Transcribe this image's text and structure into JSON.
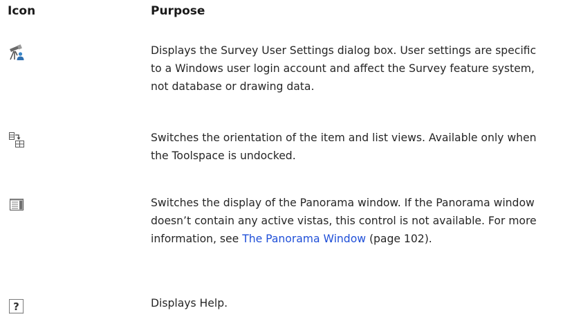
{
  "header": {
    "icon_label": "Icon",
    "purpose_label": "Purpose"
  },
  "rows": [
    {
      "icon": "survey-user-settings-icon",
      "text": "Displays the Survey User Settings dialog box. User settings are specific to a Windows user login account and affect the Survey feature system, not database or drawing data."
    },
    {
      "icon": "switch-orientation-icon",
      "text": "Switches the orientation of the item and list views. Available only when the Toolspace is undocked."
    },
    {
      "icon": "panorama-window-icon",
      "text_before": "Switches the display of the Panorama window. If the Panorama window doesn’t contain any active vistas, this control is not available. For more information, see ",
      "link": "The Panorama Window",
      "text_after": " (page 102)."
    },
    {
      "icon": "help-icon",
      "text": "Displays Help."
    }
  ]
}
